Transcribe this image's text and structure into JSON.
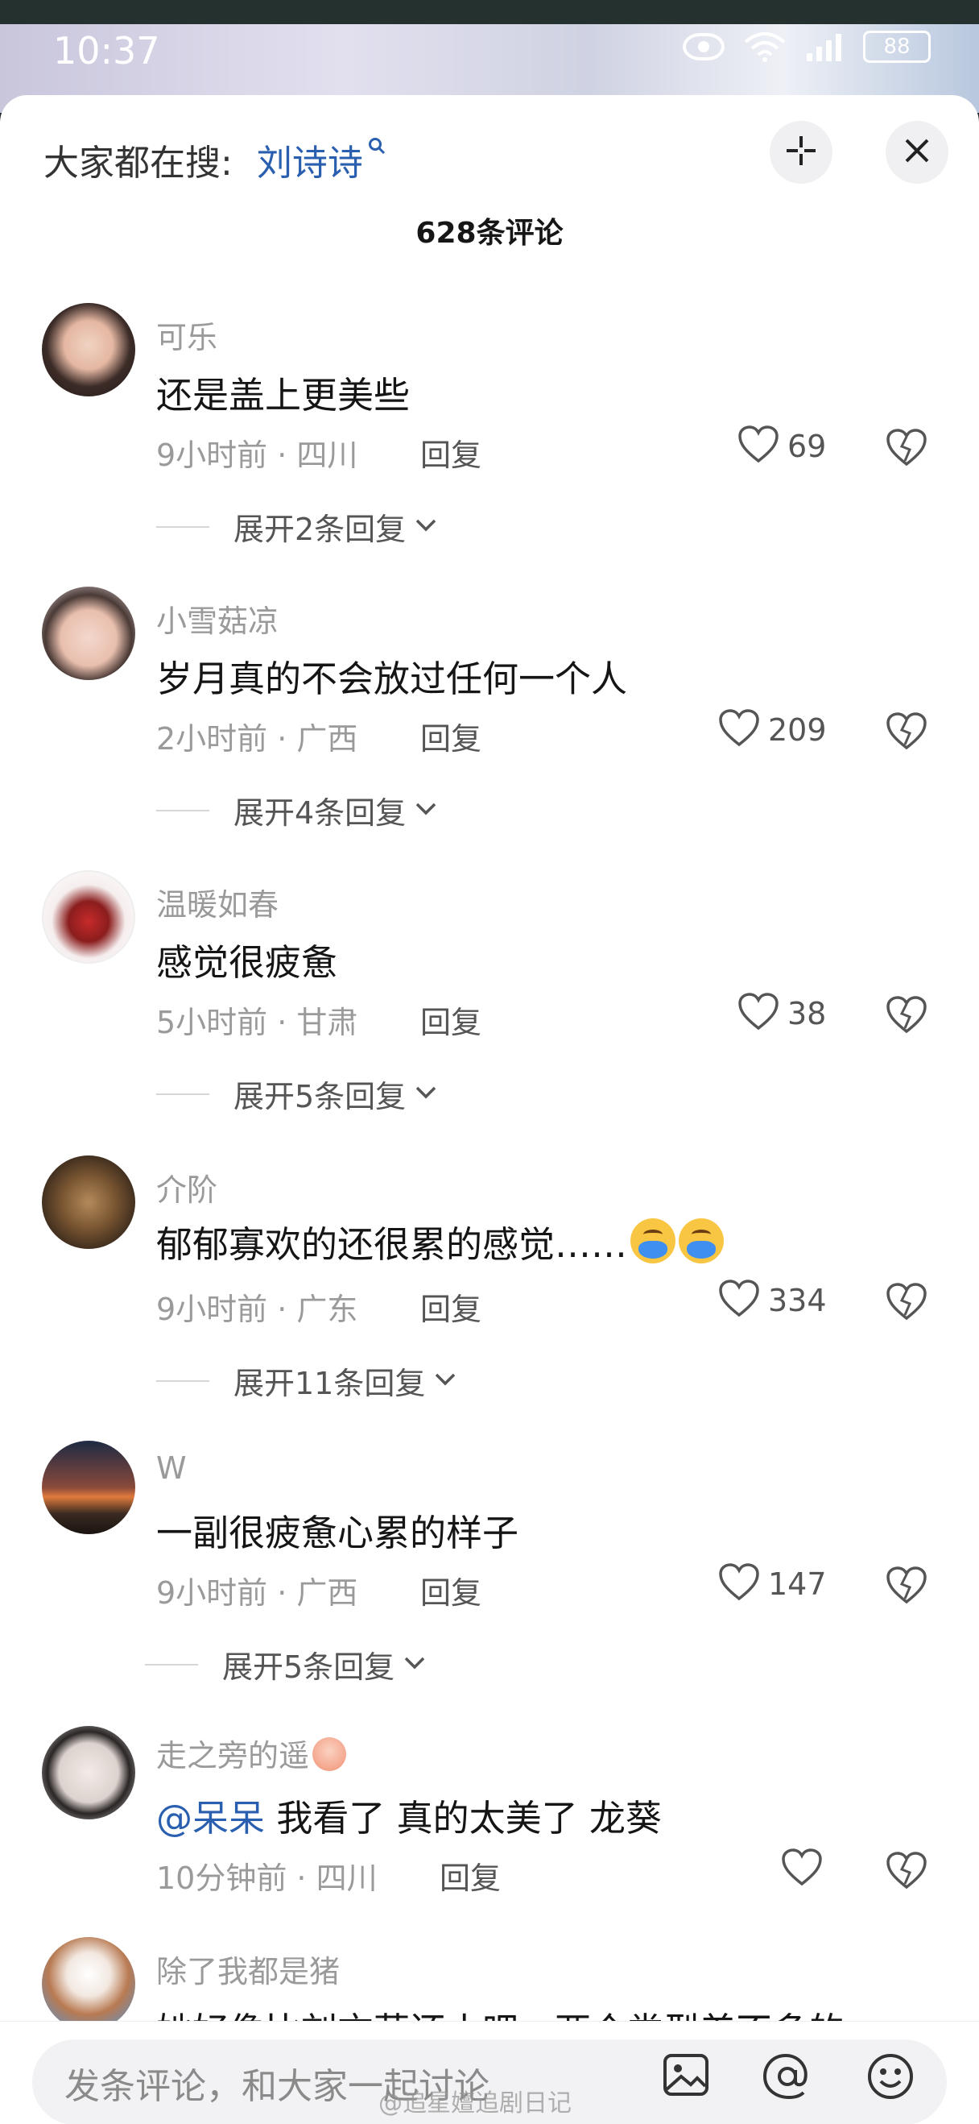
{
  "status_bar": {
    "time": "10:37",
    "battery": "88"
  },
  "header": {
    "search_prefix": "大家都在搜:",
    "search_term": "刘诗诗",
    "comment_count": "628条评论"
  },
  "comments": [
    {
      "username": "可乐",
      "text": "还是盖上更美些",
      "meta": "9小时前 · 四川",
      "reply_label": "回复",
      "likes": "69",
      "expand_label": "展开2条回复"
    },
    {
      "username": "小雪菇凉",
      "text": "岁月真的不会放过任何一个人",
      "meta": "2小时前 · 广西",
      "reply_label": "回复",
      "likes": "209",
      "expand_label": "展开4条回复"
    },
    {
      "username": "温暖如春",
      "text": "感觉很疲惫",
      "meta": "5小时前 · 甘肃",
      "reply_label": "回复",
      "likes": "38",
      "expand_label": "展开5条回复"
    },
    {
      "username": "介阶",
      "text": "郁郁寡欢的还很累的感觉……",
      "meta": "9小时前 · 广东",
      "reply_label": "回复",
      "likes": "334",
      "expand_label": "展开11条回复"
    },
    {
      "username": "W",
      "text": "一副很疲惫心累的样子",
      "meta": "9小时前 · 广西",
      "reply_label": "回复",
      "likes": "147",
      "expand_label": "展开5条回复"
    },
    {
      "username": "走之旁的遥",
      "mention": "@呆呆",
      "text": " 我看了 真的太美了 龙葵",
      "meta": "10分钟前 · 四川",
      "reply_label": "回复"
    },
    {
      "username": "除了我都是猪",
      "text": "她好像比刘亦菲还小吧，两个类型差不多的"
    }
  ],
  "bottom_bar": {
    "placeholder": "发条评论，和大家一起讨论",
    "watermark": "@追星嬗追剧日记"
  },
  "colors": {
    "accent_blue": "#2a5fb0",
    "secondary_text": "#9a9a9a",
    "primary_text": "#151515"
  }
}
